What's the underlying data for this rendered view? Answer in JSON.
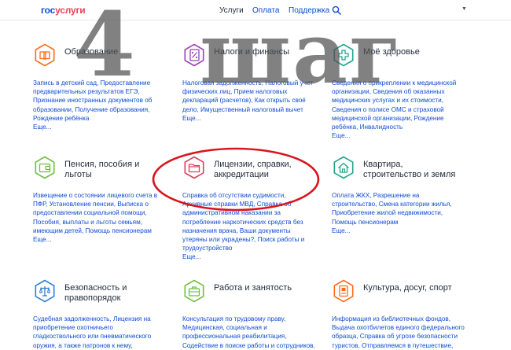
{
  "header": {
    "logo_part1": "гос",
    "logo_part2": "услуги",
    "nav": [
      "Услуги",
      "Оплата",
      "Поддержка"
    ],
    "search_icon": "search-icon",
    "dropdown_icon": "chevron-down-icon"
  },
  "overlay": {
    "number": "4",
    "word": "шаг"
  },
  "accent_color": "#0d4cd3",
  "icon_color": "#ff6b1a",
  "cards": [
    {
      "title": "Образование",
      "icon": "book-icon",
      "icon_color": "#ff6b1a",
      "links": [
        "Запись в детский сад, Предоставление",
        "предварительных результатов ЕГЭ,",
        "Признание иностранных документов об",
        "образовании, Получение образования,",
        "Рождение ребёнка",
        "Еще..."
      ]
    },
    {
      "title": "Налоги и финансы",
      "icon": "tax-document-icon",
      "icon_color": "#9b3fb5",
      "links": [
        "Налоговая задолженность, Налоговый учет",
        "физических лиц, Прием налоговых",
        "деклараций (расчетов), Как открыть своё",
        "дело, Имущественный налоговый вычет",
        "Еще..."
      ]
    },
    {
      "title": "Моё здоровье",
      "icon": "medical-cross-icon",
      "icon_color": "#22a58c",
      "links": [
        "Сведения о прикреплении к медицинской",
        "организации, Сведения об оказанных",
        "медицинских услугах и их стоимости,",
        "Сведения о полисе ОМС и страховой",
        "медицинской организации, Рождение",
        "ребёнка, Инвалидность",
        "Еще..."
      ]
    },
    {
      "title": "Пенсия, пособия и|льготы",
      "icon": "wallet-icon",
      "icon_color": "#6ebf3b",
      "links": [
        "Извещение о состоянии лицевого счета в",
        "ПФР, Установление пенсии, Выписка о",
        "предоставлении социальной помощи,",
        "Пособия, выплаты и льготы семьям,",
        "имеющим детей, Помощь пенсионерам",
        "Еще..."
      ]
    },
    {
      "title": "Лицензии, справки,|аккредитации",
      "icon": "folder-icon",
      "icon_color": "#e23d5c",
      "links": [
        "Справка об отсутствии судимости,",
        "Архивные справки МВД, Справка об",
        "административном наказании за",
        "потребление наркотических средств без",
        "назначения врача, Ваши документы",
        "утеряны или украдены?, Поиск работы и",
        "трудоустройство",
        "Еще..."
      ]
    },
    {
      "title": "Квартира,|строительство и земля",
      "icon": "house-icon",
      "icon_color": "#22a58c",
      "links": [
        "Оплата ЖКХ, Разрешение на",
        "строительство, Смена категории жилья,",
        "Приобретение жилой недвижимости,",
        "Помощь пенсионерам",
        "Еще..."
      ]
    },
    {
      "title": "Безопасность и|правопорядок",
      "icon": "scales-icon",
      "icon_color": "#2f7fd1",
      "links": [
        "Судебная задолженность, Лицензия на",
        "приобретение охотничьего",
        "гладкоствольного или пневматического",
        "оружия, а также патронов к нему,"
      ]
    },
    {
      "title": "Работа и занятость",
      "icon": "briefcase-icon",
      "icon_color": "#6ebf3b",
      "links": [
        "Консультация по трудовому праву,",
        "Медицинская, социальная и",
        "профессиональная реабилитация,",
        "Содействие в поиске работы и сотрудников,"
      ]
    },
    {
      "title": "Культура, досуг, спорт",
      "icon": "ticket-icon",
      "icon_color": "#ff6b1a",
      "links": [
        "Информация из библиотечных фондов,",
        "Выдача охотбилетов единого федерального",
        "образца, Справка об угрозе безопасности",
        "туристов, Отправляемся в путешествие,"
      ]
    }
  ]
}
